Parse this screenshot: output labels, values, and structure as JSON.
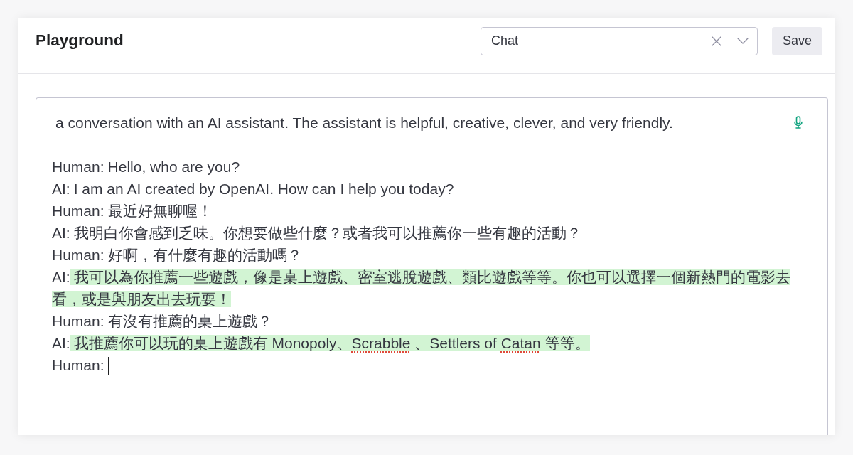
{
  "header": {
    "title": "Playground",
    "preset_select": {
      "value": "Chat"
    },
    "save_button": {
      "label": "Save"
    }
  },
  "editor": {
    "intro": "a conversation with an AI assistant. The assistant is helpful, creative, clever, and very friendly.",
    "dialogue": [
      {
        "speaker": "Human:",
        "segments": [
          {
            "text": "Hello, who are you?",
            "misspelled": false
          }
        ],
        "highlighted": false,
        "cursor": false
      },
      {
        "speaker": "AI:",
        "segments": [
          {
            "text": "I am an AI created by OpenAI. How can I help you today?",
            "misspelled": false
          }
        ],
        "highlighted": false,
        "cursor": false
      },
      {
        "speaker": "Human:",
        "segments": [
          {
            "text": "最近好無聊喔！",
            "misspelled": false
          }
        ],
        "highlighted": false,
        "cursor": false
      },
      {
        "speaker": "AI:",
        "segments": [
          {
            "text": "我明白你會感到乏味。你想要做些什麼？或者我可以推薦你一些有趣的活動？",
            "misspelled": false
          }
        ],
        "highlighted": false,
        "cursor": false
      },
      {
        "speaker": "Human:",
        "segments": [
          {
            "text": "好啊，有什麼有趣的活動嗎？",
            "misspelled": false
          }
        ],
        "highlighted": false,
        "cursor": false
      },
      {
        "speaker": "AI:",
        "segments": [
          {
            "text": "我可以為你推薦一些遊戲，像是桌上遊戲、密室逃脫遊戲、類比遊戲等等。你也可以選擇一個新熱門的電影去看，或是與朋友出去玩耍！",
            "misspelled": false
          }
        ],
        "highlighted": true,
        "cursor": false
      },
      {
        "speaker": "Human:",
        "segments": [
          {
            "text": "有沒有推薦的桌上遊戲？",
            "misspelled": false
          }
        ],
        "highlighted": false,
        "cursor": false
      },
      {
        "speaker": "AI:",
        "segments": [
          {
            "text": "我推薦你可以玩的桌上遊戲有 Monopoly、",
            "misspelled": false
          },
          {
            "text": "Scrabble",
            "misspelled": true
          },
          {
            "text": " 、Settlers of ",
            "misspelled": false
          },
          {
            "text": "Catan",
            "misspelled": true
          },
          {
            "text": " 等等。",
            "misspelled": false
          }
        ],
        "highlighted": true,
        "cursor": false
      },
      {
        "speaker": "Human:",
        "highlighted": false,
        "cursor": true
      }
    ]
  }
}
